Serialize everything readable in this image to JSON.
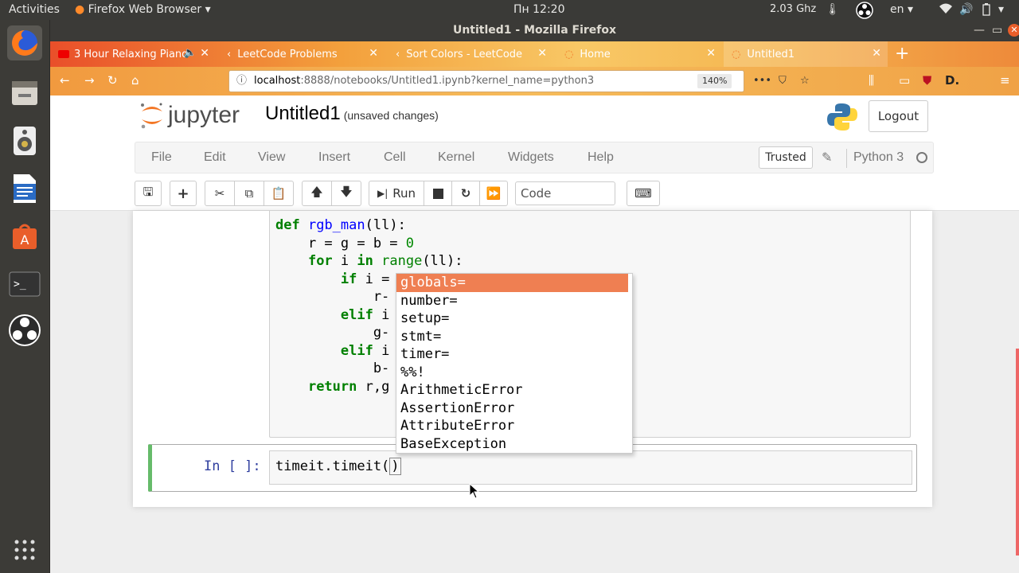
{
  "system": {
    "activities": "Activities",
    "app": "Firefox Web Browser",
    "clock": "Пн 12:20",
    "cpu": "2.03 Ghz",
    "lang": "en"
  },
  "window": {
    "title": "Untitled1 - Mozilla Firefox"
  },
  "tabs": [
    {
      "label": "3 Hour Relaxing Piano",
      "favicon": "youtube-icon"
    },
    {
      "label": "LeetCode Problems",
      "favicon": "leetcode-icon"
    },
    {
      "label": "Sort Colors - LeetCode",
      "favicon": "leetcode-icon"
    },
    {
      "label": "Home",
      "favicon": "jupyter-icon"
    },
    {
      "label": "Untitled1",
      "favicon": "jupyter-icon"
    }
  ],
  "address": {
    "host": "localhost",
    "rest": ":8888/notebooks/Untitled1.ipynb?kernel_name=python3",
    "zoom": "140%"
  },
  "jupyter": {
    "logo_text": "jupyter",
    "notebook_name": "Untitled1",
    "save_status": "(unsaved changes)",
    "logout": "Logout"
  },
  "menu": [
    "File",
    "Edit",
    "View",
    "Insert",
    "Cell",
    "Kernel",
    "Widgets",
    "Help"
  ],
  "trusted": "Trusted",
  "kernel": "Python 3",
  "toolbar": {
    "run": "Run",
    "cell_type": "Code"
  },
  "cell1": {
    "lines": [
      "def rgb_man(ll):",
      "    r = g = b = 0",
      "    for i in range(ll):",
      "        if i = 0",
      "            r-",
      "        elif i",
      "            g-",
      "        elif i",
      "            b-",
      "    return r,g"
    ]
  },
  "cell2": {
    "prompt": "In [ ]:",
    "code": "timeit.timeit(",
    "close": ")"
  },
  "completer": [
    "globals=",
    "number=",
    "setup=",
    "stmt=",
    "timer=",
    "%%!",
    "ArithmeticError",
    "AssertionError",
    "AttributeError",
    "BaseException"
  ],
  "colors": {
    "accent": "#ef7f52",
    "edit_border": "#66bb6a",
    "prompt": "#303f9f"
  }
}
